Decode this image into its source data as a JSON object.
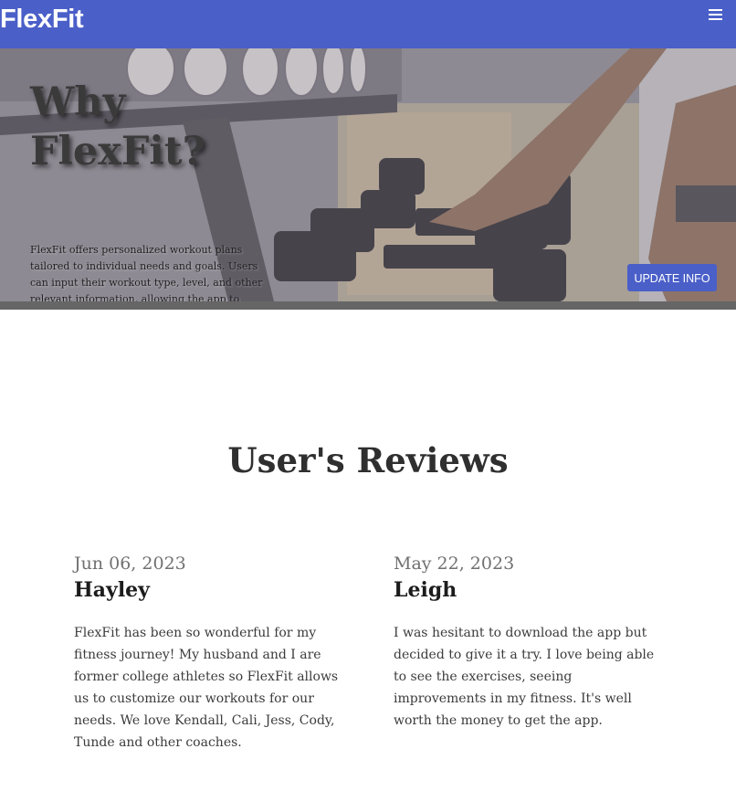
{
  "navbar": {
    "brand": "FlexFit",
    "menu_icon": "hamburger-menu-icon",
    "background": "#4a5fc8"
  },
  "hero": {
    "image": "gym-dumbbell-rack-photo",
    "title_line1": "Why",
    "title_line2": "FlexFit?",
    "description": "FlexFit offers personalized workout plans tailored to individual needs and goals. Users can input their workout type, level, and other relevant information, allowing the app to generate customized exercise routines that suit their specific requirements.",
    "button_label": "UPDATE INFO"
  },
  "reviews": {
    "heading": "User's Reviews",
    "items": [
      {
        "date": "Jun 06, 2023",
        "name": "Hayley",
        "text": "FlexFit has been so wonderful for my fitness journey! My husband and I are former college athletes so FlexFit allows us to customize our workouts for our needs. We love Kendall, Cali, Jess, Cody, Tunde and other coaches."
      },
      {
        "date": "May 22, 2023",
        "name": "Leigh",
        "text": "I was hesitant to download the app but decided to give it a try. I love being able to see the exercises, seeing improvements in my fitness. It's well worth the money to get the app."
      }
    ]
  }
}
